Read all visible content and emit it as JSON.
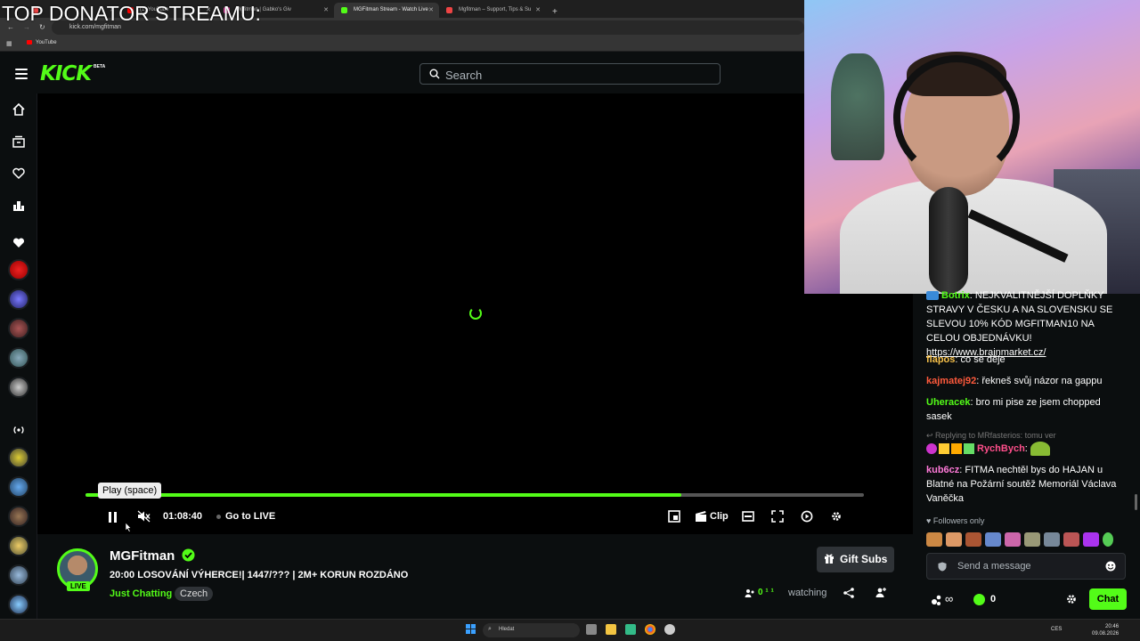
{
  "overlay": {
    "banner": "TOP DONATOR STREAMU:"
  },
  "browser": {
    "tabs": [
      {
        "label": "",
        "active": false,
        "color": "#e44"
      },
      {
        "label": "(1) YouTube",
        "active": false,
        "color": "#f00"
      },
      {
        "label": "Mgfitman | Gabko's Giv",
        "active": false,
        "color": "#e4a"
      },
      {
        "label": "MGFitman Stream - Watch Live",
        "active": true,
        "color": "#53fc18"
      },
      {
        "label": "Mgfitman – Support, Tips & Su",
        "active": false,
        "color": "#e44"
      }
    ],
    "new_tab": "+",
    "url": "kick.com/mgfitman",
    "bookmarks": [
      "YouTube"
    ]
  },
  "header": {
    "logo": "KICK",
    "logo_badge": "BETA",
    "search_placeholder": "Search"
  },
  "player": {
    "tooltip": "Play (space)",
    "time": "01:08:40",
    "go_live": "Go to LIVE",
    "clip_label": "Clip",
    "progress": 0.765
  },
  "stream": {
    "channel": "MGFitman",
    "live_badge": "LIVE",
    "title": "20:00 LOSOVÁNÍ VÝHERCE!| 1447/??? | 2M+ KORUN ROZDÁNO",
    "category": "Just Chatting",
    "tag": "Czech",
    "gift_subs": "Gift Subs",
    "viewers": "0 ¹ ¹",
    "watching": "watching"
  },
  "chat": {
    "messages": [
      {
        "user": "Botrix",
        "color": "#53fc18",
        "text": "NEJKVALITNĚJŠÍ DOPLŇKY STRAVY V ČESKU A NA SLOVENSKU SE SLEVOU 10% KÓD MGFITMAN10 NA CELOU OBJEDNÁVKU! ",
        "link": "https://www.brainmarket.cz/"
      },
      {
        "user": "flapos",
        "color": "#f7c14a",
        "text": "co se děje"
      },
      {
        "user": "kajmatej92",
        "color": "#ff5a3c",
        "text": "řekneš svůj názor na gappu"
      },
      {
        "user": "Uheracek",
        "color": "#53fc18",
        "text": "bro mi pise ze jsem chopped sasek"
      },
      {
        "user": "RychBych",
        "color": "#ff4f8b",
        "text": ""
      },
      {
        "user": "kub6cz",
        "color": "#ff7ad9",
        "text": "FITMA nechtěl bys do HAJAN u Blatné na Požární soutěž Memoriál Václava Vaněčka"
      }
    ],
    "reply_context": "Replying to MRfasterios: tomu ver",
    "followers_only": "Followers only",
    "input_placeholder": "Send a message",
    "points": "∞",
    "coins": "0",
    "send_button": "Chat"
  },
  "taskbar": {
    "search": "Hledat",
    "lang": "CES",
    "time": "20:46",
    "date": "09.08.2026"
  }
}
